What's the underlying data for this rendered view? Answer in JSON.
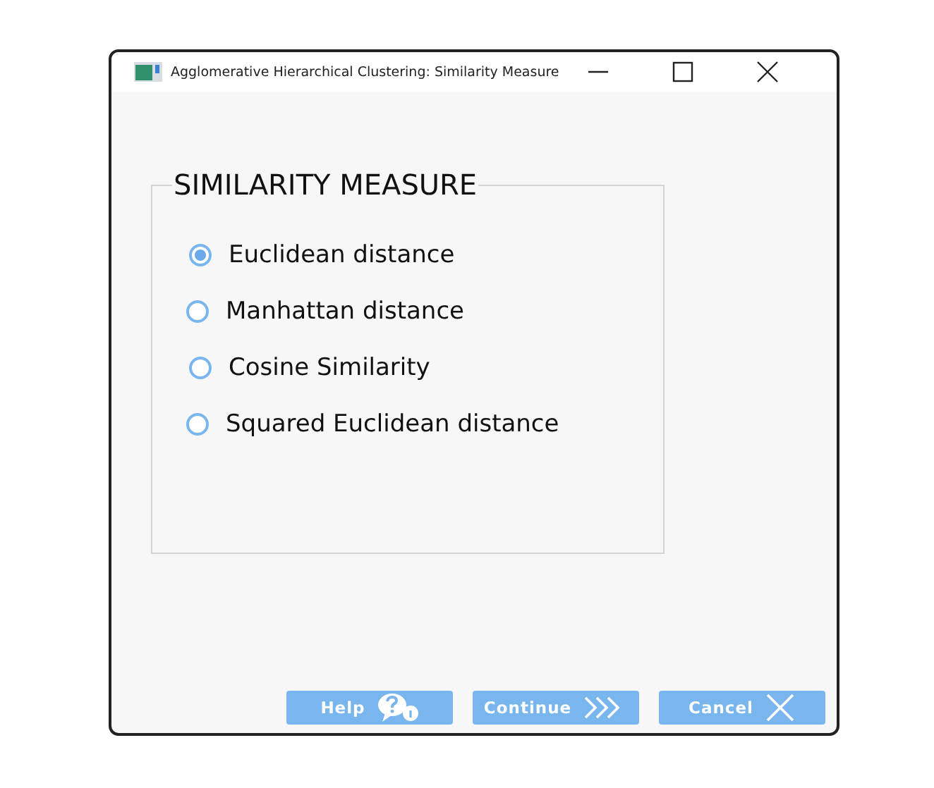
{
  "window": {
    "title": "Agglomerative Hierarchical Clustering: Similarity Measure"
  },
  "group": {
    "title": "SIMILARITY MEASURE",
    "options": [
      {
        "label": "Euclidean distance",
        "selected": true
      },
      {
        "label": "Manhattan distance",
        "selected": false
      },
      {
        "label": "Cosine Similarity",
        "selected": false
      },
      {
        "label": "Squared Euclidean distance",
        "selected": false
      }
    ]
  },
  "buttons": [
    {
      "label": "Help",
      "kind": "help"
    },
    {
      "label": "Continue",
      "kind": "continue"
    },
    {
      "label": "Cancel",
      "kind": "cancel"
    }
  ]
}
